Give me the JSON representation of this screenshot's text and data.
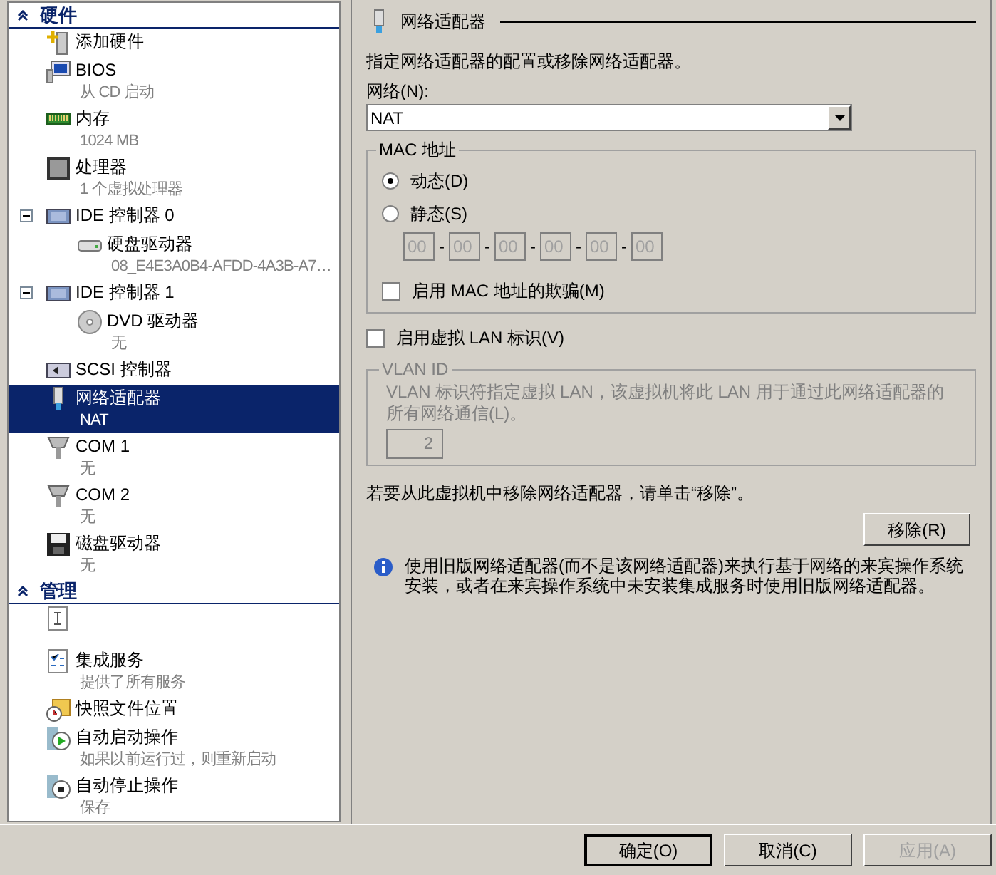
{
  "sidebar": {
    "sections": [
      {
        "title": "硬件",
        "expanded": true,
        "items": [
          {
            "kind": "add",
            "name": "添加硬件",
            "selected": false
          },
          {
            "kind": "bios",
            "name": "BIOS",
            "detail": "从 CD 启动",
            "selected": false
          },
          {
            "kind": "memory",
            "name": "内存",
            "detail": "1024 MB",
            "selected": false
          },
          {
            "kind": "cpu",
            "name": "处理器",
            "detail": "1 个虚拟处理器",
            "selected": false
          },
          {
            "kind": "ide",
            "name": "IDE 控制器 0",
            "selected": false,
            "expanded": true,
            "children": [
              {
                "kind": "disk",
                "name": "硬盘驱动器",
                "detail": "08_E4E3A0B4-AFDD-4A3B-A7…",
                "selected": false
              }
            ]
          },
          {
            "kind": "ide",
            "name": "IDE 控制器 1",
            "selected": false,
            "expanded": true,
            "children": [
              {
                "kind": "dvd",
                "name": "DVD 驱动器",
                "detail": "无",
                "selected": false
              }
            ]
          },
          {
            "kind": "scsi",
            "name": "SCSI 控制器",
            "selected": false
          },
          {
            "kind": "nic",
            "name": "网络适配器",
            "detail": "NAT",
            "selected": true
          },
          {
            "kind": "com",
            "name": "COM 1",
            "detail": "无",
            "selected": false
          },
          {
            "kind": "com",
            "name": "COM 2",
            "detail": "无",
            "selected": false
          },
          {
            "kind": "floppy",
            "name": "磁盘驱动器",
            "detail": "无",
            "selected": false
          }
        ]
      },
      {
        "title": "管理",
        "expanded": true,
        "items": [
          {
            "kind": "name",
            "selected": false
          },
          {
            "kind": "services",
            "name": "集成服务",
            "detail": "提供了所有服务",
            "selected": false
          },
          {
            "kind": "snapshot",
            "name": "快照文件位置",
            "selected": false
          },
          {
            "kind": "start",
            "name": "自动启动操作",
            "detail": "如果以前运行过，则重新启动",
            "selected": false
          },
          {
            "kind": "stop",
            "name": "自动停止操作",
            "detail": "保存",
            "selected": false
          }
        ]
      }
    ]
  },
  "panel": {
    "title": "网络适配器",
    "description": "指定网络适配器的配置或移除网络适配器。",
    "network": {
      "label": "网络(N):",
      "value": "NAT"
    },
    "mac": {
      "title": "MAC 地址",
      "options": [
        {
          "label": "动态(D)",
          "selected": true
        },
        {
          "label": "静态(S)",
          "selected": false
        }
      ],
      "octets": [
        "00",
        "00",
        "00",
        "00",
        "00",
        "00"
      ],
      "octets_disabled": true,
      "separator": "-",
      "spoofing": {
        "label": "启用 MAC 地址的欺骗(M)",
        "checked": false
      }
    },
    "vlan_toggle": {
      "label": "启用虚拟 LAN 标识(V)",
      "checked": false
    },
    "vlan": {
      "title": "VLAN ID",
      "disabled": true,
      "text": "VLAN 标识符指定虚拟 LAN，该虚拟机将此 LAN 用于通过此网络适配器的所有网络通信(L)。",
      "value": "2"
    },
    "remove_text": "若要从此虚拟机中移除网络适配器，请单击“移除”。",
    "remove_button": "移除(R)",
    "info": "使用旧版网络适配器(而不是该网络适配器)来执行基于网络的来宾操作系统安装，或者在来宾操作系统中未安装集成服务时使用旧版网络适配器。"
  },
  "buttons": [
    {
      "label": "确定(O)",
      "default": true,
      "disabled": false
    },
    {
      "label": "取消(C)",
      "default": false,
      "disabled": false
    },
    {
      "label": "应用(A)",
      "default": false,
      "disabled": true
    }
  ]
}
